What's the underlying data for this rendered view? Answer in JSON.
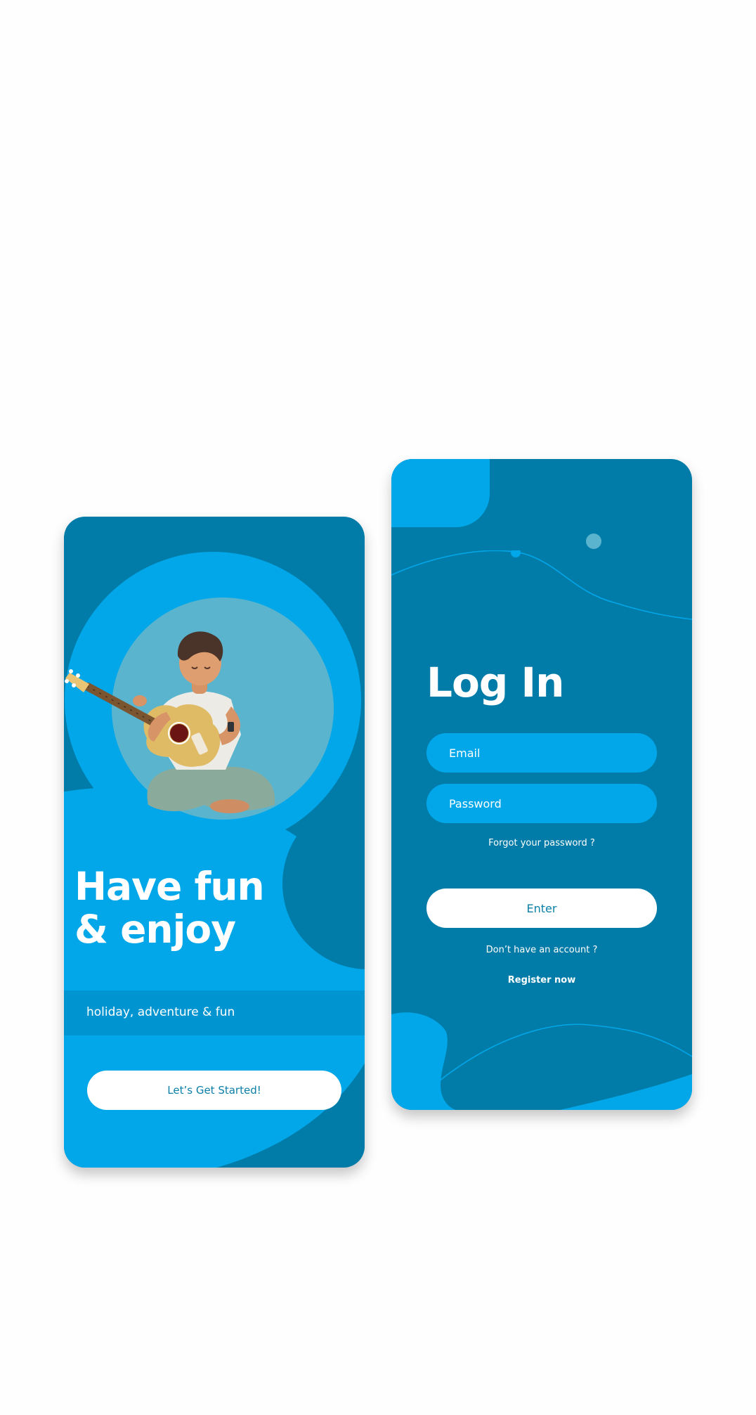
{
  "welcome": {
    "headline_line1": "Have fun",
    "headline_line2": "& enjoy",
    "subtitle": "holiday, adventure & fun",
    "cta_label": "Let’s Get Started!",
    "illustration_icon": "guitar-player-illustration"
  },
  "login": {
    "title": "Log In",
    "email_placeholder": "Email",
    "password_placeholder": "Password",
    "forgot_label": "Forgot your password ?",
    "enter_label": "Enter",
    "no_account_label": "Don’t have an account ?",
    "register_label": "Register now"
  },
  "colors": {
    "dark_blue": "#017ca9",
    "bright_blue": "#01a7e9",
    "muted_teal": "#5bb4cd",
    "band_blue": "#0095d0",
    "button_text": "#0b7fa8",
    "background": "#fefefe"
  }
}
